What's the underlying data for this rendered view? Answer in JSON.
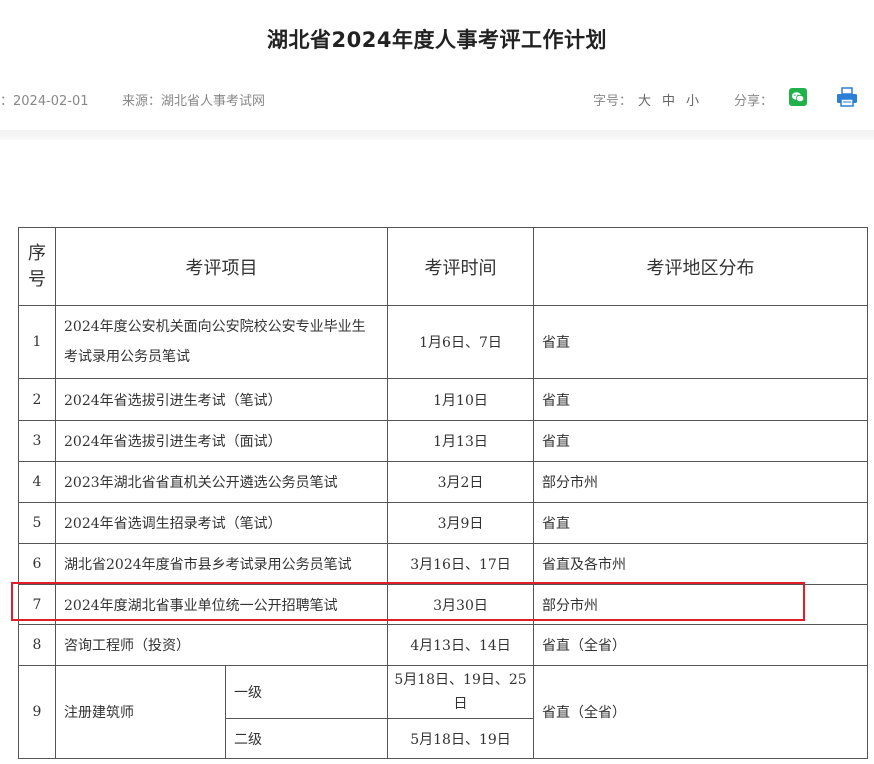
{
  "page": {
    "title": "湖北省2024年度人事考评工作计划"
  },
  "meta": {
    "date": "：2024-02-01",
    "source": "来源：湖北省人事考试网",
    "font_size_label": "字号：",
    "font_size_options": [
      "大",
      "中",
      "小"
    ],
    "share_label": "分享：",
    "wechat_color": "#21b14a",
    "print_color": "#2b7fd6"
  },
  "table": {
    "headers": {
      "seq": "序号",
      "item": "考评项目",
      "time": "考评时间",
      "region": "考评地区分布"
    },
    "rows": [
      {
        "seq": "1",
        "item": "2024年度公安机关面向公安院校公安专业毕业生考试录用公务员笔试",
        "time": "1月6日、7日",
        "region": "省直"
      },
      {
        "seq": "2",
        "item": "2024年省选拔引进生考试（笔试）",
        "time": "1月10日",
        "region": "省直"
      },
      {
        "seq": "3",
        "item": "2024年省选拔引进生考试（面试）",
        "time": "1月13日",
        "region": "省直"
      },
      {
        "seq": "4",
        "item": "2023年湖北省省直机关公开遴选公务员笔试",
        "time": "3月2日",
        "region": "部分市州"
      },
      {
        "seq": "5",
        "item": "2024年省选调生招录考试（笔试）",
        "time": "3月9日",
        "region": "省直"
      },
      {
        "seq": "6",
        "item": "湖北省2024年度省市县乡考试录用公务员笔试",
        "time": "3月16日、17日",
        "region": "省直及各市州"
      },
      {
        "seq": "7",
        "item": "2024年度湖北省事业单位统一公开招聘笔试",
        "time": "3月30日",
        "region": "部分市州"
      },
      {
        "seq": "8",
        "item": "咨询工程师（投资）",
        "time": "4月13日、14日",
        "region": "省直（全省）"
      },
      {
        "seq": "9",
        "item": "注册建筑师",
        "sub": [
          {
            "level": "一级",
            "time": "5月18日、19日、25日"
          },
          {
            "level": "二级",
            "time": "5月18日、19日"
          }
        ],
        "region": "省直（全省）"
      }
    ]
  }
}
